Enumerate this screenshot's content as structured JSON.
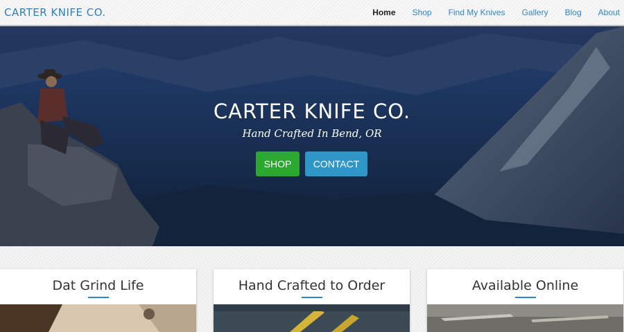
{
  "nav": {
    "brand": "CARTER KNIFE CO.",
    "items": [
      {
        "label": "Home",
        "active": true
      },
      {
        "label": "Shop"
      },
      {
        "label": "Find My Knives"
      },
      {
        "label": "Gallery"
      },
      {
        "label": "Blog"
      },
      {
        "label": "About"
      }
    ]
  },
  "hero": {
    "title": "CARTER KNIFE CO.",
    "subtitle": "Hand Crafted In Bend, OR",
    "shop_button": "SHOP",
    "contact_button": "CONTACT"
  },
  "cards": [
    {
      "title": "Dat Grind Life"
    },
    {
      "title": "Hand Crafted to Order"
    },
    {
      "title": "Available Online"
    }
  ],
  "colors": {
    "brand_blue": "#2e7fb8",
    "shop_green": "#2aa82f",
    "contact_blue": "#2e97c8"
  }
}
